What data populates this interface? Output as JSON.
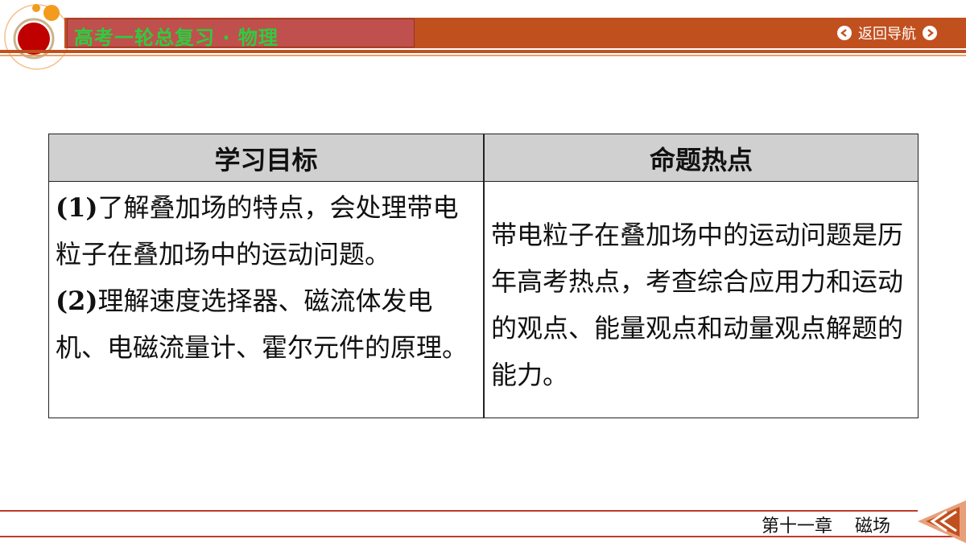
{
  "header": {
    "course": "高考一轮总复习 · 物理",
    "nav_back_label": "返回导航"
  },
  "table": {
    "headers": [
      "学习目标",
      "命题热点"
    ],
    "objectives": [
      {
        "num": "(1)",
        "text": "了解叠加场的特点，会处理带电粒子在叠加场中的运动问题。"
      },
      {
        "num": "(2)",
        "text": "理解速度选择器、磁流体发电机、电磁流量计、霍尔元件的原理。"
      }
    ],
    "hotspot": "带电粒子在叠加场中的运动问题是历年高考热点，考查综合应用力和运动的观点、能量观点和动量观点解题的能力。"
  },
  "footer": {
    "chapter": "第十一章",
    "topic": "磁场"
  },
  "colors": {
    "bar": "#c1501f",
    "tab": "#c0504d",
    "title_green": "#2ecc40",
    "table_head": "#d0d0d0",
    "footer_line": "#c0392b"
  }
}
